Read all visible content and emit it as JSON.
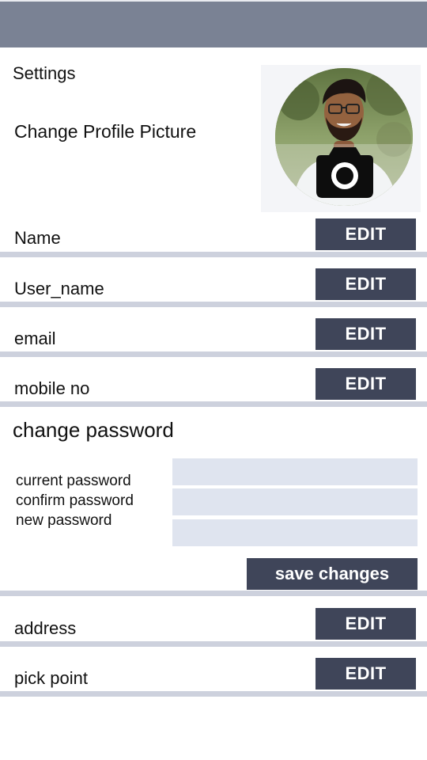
{
  "header": {
    "title": "Settings"
  },
  "profile": {
    "change_picture_label": "Change Profile Picture",
    "camera_icon": "camera-icon"
  },
  "fields": [
    {
      "label": "Name",
      "action": "EDIT"
    },
    {
      "label": "User_name",
      "action": "EDIT"
    },
    {
      "label": "email",
      "action": "EDIT"
    },
    {
      "label": "mobile no",
      "action": "EDIT"
    }
  ],
  "password": {
    "title": "change password",
    "current_label": "current password",
    "confirm_label": "confirm password",
    "new_label": "new password",
    "save_label": "save changes"
  },
  "more_fields": [
    {
      "label": "address",
      "action": "EDIT"
    },
    {
      "label": "pick point",
      "action": "EDIT"
    }
  ],
  "colors": {
    "topbar": "#7a8294",
    "button": "#3f4559",
    "divider": "#cdd1dd",
    "input": "#dfe4ef"
  }
}
